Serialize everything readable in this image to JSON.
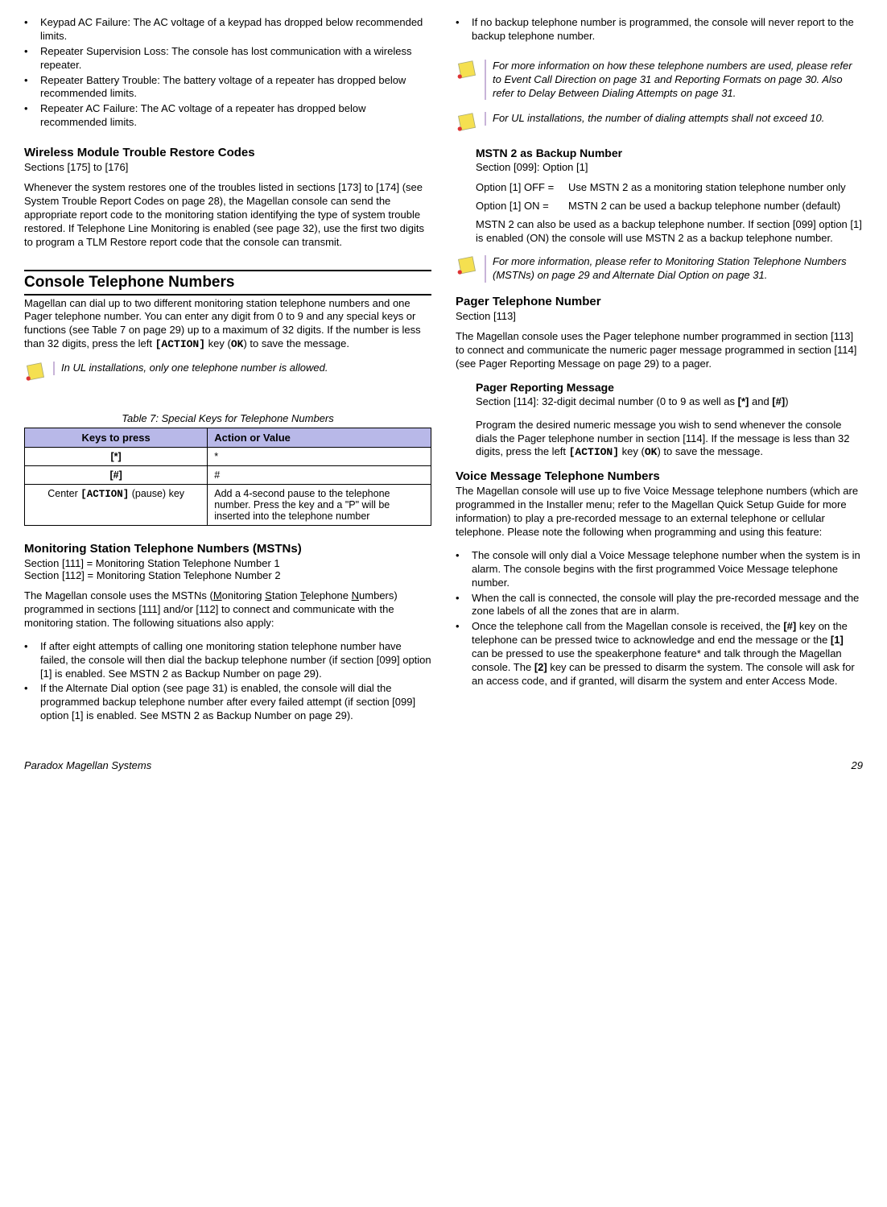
{
  "col1": {
    "top_bullets": [
      "Keypad AC Failure: The AC voltage of a keypad has dropped below recommended limits.",
      "Repeater Supervision Loss: The console has lost communication with a wireless repeater.",
      "Repeater Battery Trouble: The battery voltage of a repeater has dropped below recommended limits.",
      "Repeater AC Failure: The AC voltage of a repeater has dropped below recommended limits."
    ],
    "wmtrc_heading": "Wireless Module Trouble Restore Codes",
    "wmtrc_ref": "Sections [175] to [176]",
    "wmtrc_body": "Whenever the system restores one of the troubles listed in sections [173] to [174] (see System Trouble Report Codes on page 28), the Magellan console can send the appropriate report code to the monitoring station identifying the type of system trouble restored. If Telephone Line Monitoring is enabled (see page 32), use the first two digits to program a TLM Restore report code that the console can transmit.",
    "ctn_heading": "Console Telephone Numbers",
    "ctn_body_pre": "Magellan can dial up to two different monitoring station telephone numbers and one Pager telephone number. You can enter any digit from 0 to 9 and any special keys or functions (see Table 7 on page 29) up to a maximum of 32 digits. If the number is less than 32 digits, press the left ",
    "action_key": "[ACTION]",
    "ctn_body_mid": " key (",
    "ok_key": "OK",
    "ctn_body_post": ") to save the message.",
    "note1": "In UL installations, only one telephone number is allowed.",
    "table_caption": "Table 7: Special Keys for Telephone Numbers",
    "th1": "Keys to press",
    "th2": "Action or Value",
    "row1_key": "[*]",
    "row1_val": "*",
    "row2_key": "[#]",
    "row2_val": "#",
    "row3_key_pre": "Center ",
    "row3_key_mono": "[ACTION]",
    "row3_key_post": " (pause) key",
    "row3_val": "Add a 4-second pause to the telephone number. Press the key and a \"P\" will be inserted into the telephone number",
    "mstn_heading": "Monitoring Station Telephone Numbers (MSTNs)",
    "mstn_ref1": "Section [111] = Monitoring Station Telephone Number 1",
    "mstn_ref2": "Section [112] = Monitoring Station Telephone Number 2",
    "mstn_body_a": "The Magellan console uses the MSTNs (",
    "mstn_body_b": "onitoring ",
    "mstn_body_c": "tation ",
    "mstn_body_d": "elephone ",
    "mstn_body_e": "umbers) programmed in sections [111] and/or [112] to connect and communicate with the monitoring station. The following situations also apply:",
    "mstn_bullets": [
      "If after eight attempts of calling one monitoring station telephone number have failed, the console will then dial the backup telephone number (if section [099] option [1] is enabled. See MSTN 2 as Backup Number on page 29).",
      "If the Alternate Dial option (see page 31) is enabled, the console will dial the programmed backup telephone number after every failed attempt (if section [099] option [1] is enabled. See MSTN 2 as Backup Number on page 29)."
    ]
  },
  "col2": {
    "top_bullet": "If no backup telephone number is programmed, the console will never report to the backup telephone number.",
    "note2": "For more information on how these telephone numbers are used, please refer to Event Call Direction on page 31 and Reporting Formats on page 30. Also refer to Delay Between Dialing Attempts on page 31.",
    "note3": "For UL installations, the number of dialing attempts shall not exceed 10.",
    "mstn2_heading": "MSTN 2 as Backup Number",
    "mstn2_ref": "Section [099]: Option [1]",
    "opt_off_label": "Option [1] OFF =",
    "opt_off_val": "Use MSTN 2 as a monitoring station telephone number only",
    "opt_on_label": "Option [1] ON =",
    "opt_on_val": "MSTN 2 can be used a backup telephone number (default)",
    "mstn2_body": "MSTN 2 can also be used as a backup telephone number. If section [099] option [1] is enabled (ON) the console will use MSTN 2 as a backup telephone number.",
    "note4": "For more information, please refer to Monitoring Station Telephone Numbers (MSTNs) on page 29 and Alternate Dial Option on page 31.",
    "pager_heading": "Pager Telephone Number",
    "pager_ref": "Section [113]",
    "pager_body": "The Magellan console uses the Pager telephone number programmed in section [113] to connect and communicate the numeric pager message programmed in section [114] (see Pager Reporting Message on page 29) to a pager.",
    "prm_heading": "Pager Reporting Message",
    "prm_ref_pre": "Section [114]: 32-digit decimal number (0 to 9 as well as ",
    "prm_star": "[*]",
    "prm_and": " and ",
    "prm_hash": "[#]",
    "prm_close": ")",
    "prm_body_pre": "Program the desired numeric message you wish to send whenever the console dials the Pager telephone number in section [114]. If the message is less than 32 digits, press the left ",
    "prm_action": "[ACTION]",
    "prm_mid": " key (",
    "prm_ok": "OK",
    "prm_post": ") to save the message.",
    "vmtn_heading": "Voice Message Telephone Numbers",
    "vmtn_body": "The Magellan console will use up to five Voice Message telephone numbers (which are programmed in the Installer menu; refer to the Magellan Quick Setup Guide for more information) to play a pre-recorded message to an external telephone or cellular telephone. Please note the following when programming and using this feature:",
    "vmtn_b1": "The console will only dial a Voice Message telephone number when the system is in alarm. The console begins with the first programmed Voice Message telephone number.",
    "vmtn_b2": "When the call is connected, the console will play the pre-recorded message and the zone labels of all the zones that are in alarm.",
    "vmtn_b3_a": "Once the telephone call from the Magellan console is received, the ",
    "vmtn_b3_hash": "[#]",
    "vmtn_b3_b": " key on the telephone can be pressed twice to acknowledge and end the message or the ",
    "vmtn_b3_one": "[1]",
    "vmtn_b3_c": " can be pressed to use the speakerphone feature* and talk through the Magellan console. The ",
    "vmtn_b3_two": "[2]",
    "vmtn_b3_d": " key can be pressed to disarm the system. The console will ask for an access code, and if granted, will disarm the system and enter Access Mode."
  },
  "footer_left": "Paradox Magellan Systems",
  "footer_right": "29"
}
